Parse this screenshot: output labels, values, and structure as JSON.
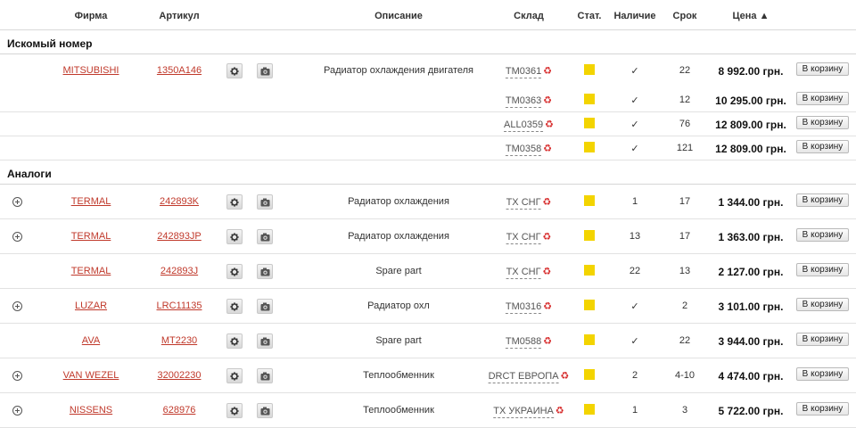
{
  "header": {
    "firm": "Фирма",
    "article": "Артикул",
    "description": "Описание",
    "warehouse": "Склад",
    "stat": "Стат.",
    "availability": "Наличие",
    "term": "Срок",
    "price": "Цена ▲"
  },
  "sections": {
    "searched": "Искомый номер",
    "analogs": "Аналоги"
  },
  "cart_label": "В корзину",
  "colors": {
    "link": "#c0392b",
    "status": "#f3d400"
  },
  "icons": {
    "recycle": "♻",
    "check": "✓"
  },
  "searched_rows": [
    {
      "firm": "MITSUBISHI",
      "article": "1350A146",
      "description": "Радиатор охлаждения двигателя",
      "warehouse": "TM0361",
      "availability": "✓",
      "term": "22",
      "price": "8 992.00 грн."
    },
    {
      "warehouse": "TM0363",
      "availability": "✓",
      "term": "12",
      "price": "10 295.00 грн."
    },
    {
      "warehouse": "ALL0359",
      "availability": "✓",
      "term": "76",
      "price": "12 809.00 грн."
    },
    {
      "warehouse": "TM0358",
      "availability": "✓",
      "term": "121",
      "price": "12 809.00 грн."
    }
  ],
  "analog_rows": [
    {
      "firm": "TERMAL",
      "article": "242893K",
      "description": "Радиатор охлаждения",
      "warehouse": "TX СНГ",
      "availability": "1",
      "term": "17",
      "price": "1 344.00 грн."
    },
    {
      "firm": "TERMAL",
      "article": "242893JP",
      "description": "Радиатор охлаждения",
      "warehouse": "TX СНГ",
      "availability": "13",
      "term": "17",
      "price": "1 363.00 грн."
    },
    {
      "firm": "TERMAL",
      "article": "242893J",
      "description": "Spare part",
      "warehouse": "TX СНГ",
      "availability": "22",
      "term": "13",
      "price": "2 127.00 грн."
    },
    {
      "firm": "LUZAR",
      "article": "LRC11135",
      "description": "Радиатор охл",
      "warehouse": "TM0316",
      "availability": "✓",
      "term": "2",
      "price": "3 101.00 грн."
    },
    {
      "firm": "AVA",
      "article": "MT2230",
      "description": "Spare part",
      "warehouse": "TM0588",
      "availability": "✓",
      "term": "22",
      "price": "3 944.00 грн."
    },
    {
      "firm": "VAN WEZEL",
      "article": "32002230",
      "description": "Теплообменник",
      "warehouse": "DRCT ЕВРОПА",
      "availability": "2",
      "term": "4-10",
      "price": "4 474.00 грн."
    },
    {
      "firm": "NISSENS",
      "article": "628976",
      "description": "Теплообменник",
      "warehouse": "TX УКРАИНА",
      "availability": "1",
      "term": "3",
      "price": "5 722.00 грн."
    }
  ]
}
